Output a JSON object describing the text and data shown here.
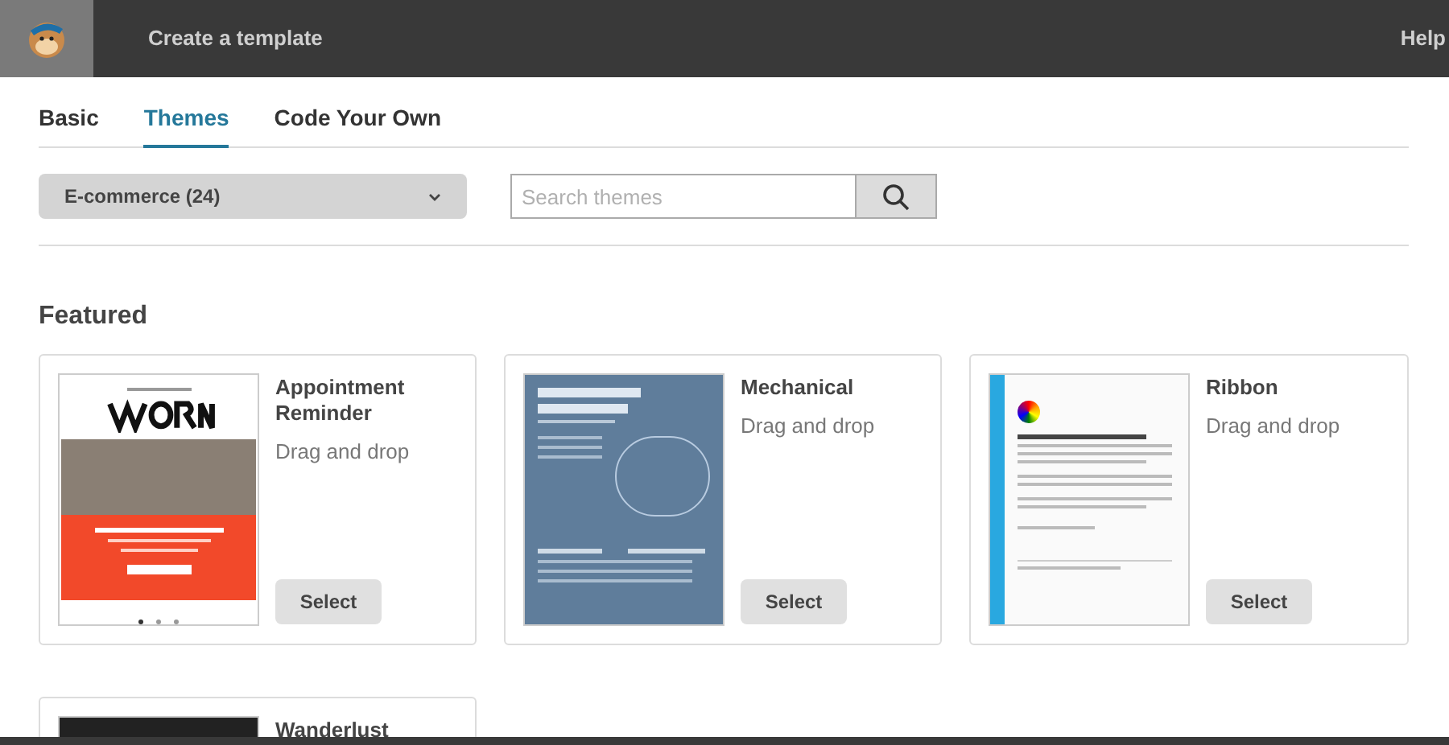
{
  "header": {
    "title": "Create a template",
    "help": "Help"
  },
  "tabs": [
    {
      "label": "Basic",
      "selected": false
    },
    {
      "label": "Themes",
      "selected": true
    },
    {
      "label": "Code Your Own",
      "selected": false
    }
  ],
  "filter": {
    "value": "E-commerce (24)"
  },
  "search": {
    "placeholder": "Search themes"
  },
  "section_title": "Featured",
  "templates": [
    {
      "kind": "reminder",
      "name": "Appointment Reminder",
      "subtitle": "Drag and drop",
      "button": "Select"
    },
    {
      "kind": "blueprint",
      "name": "Mechanical",
      "subtitle": "Drag and drop",
      "button": "Select"
    },
    {
      "kind": "letter",
      "name": "Ribbon",
      "subtitle": "Drag and drop",
      "button": "Select"
    },
    {
      "kind": "travel",
      "name": "Wanderlust"
    }
  ]
}
